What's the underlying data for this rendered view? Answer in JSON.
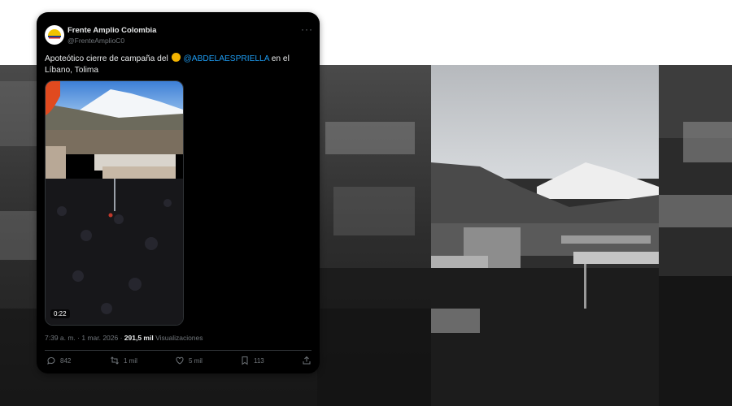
{
  "tweet": {
    "author_name": "Frente Amplio Colombia",
    "author_handle": "@FrenteAmplioC0",
    "more_label": "···",
    "text_before": "Apoteótico cierre de campaña del ",
    "mention": "@ABDELAESPRIELLA",
    "text_after": " en el Líbano, Tolima",
    "video_duration": "0:22",
    "timestamp": "7:39 a. m. · 1 mar. 2026 · ",
    "views_count": "291,5 mil",
    "views_label": " Visualizaciones",
    "actions": {
      "replies": "842",
      "retweets": "1 mil",
      "likes": "5 mil",
      "bookmarks": "113"
    }
  },
  "icons": [
    "reply-icon",
    "retweet-icon",
    "like-icon",
    "bookmark-icon",
    "share-icon",
    "more-icon"
  ],
  "colors": {
    "tweet_bg": "#000000",
    "text": "#e7e9ea",
    "muted": "#71767b",
    "mention": "#1d9bf0"
  }
}
